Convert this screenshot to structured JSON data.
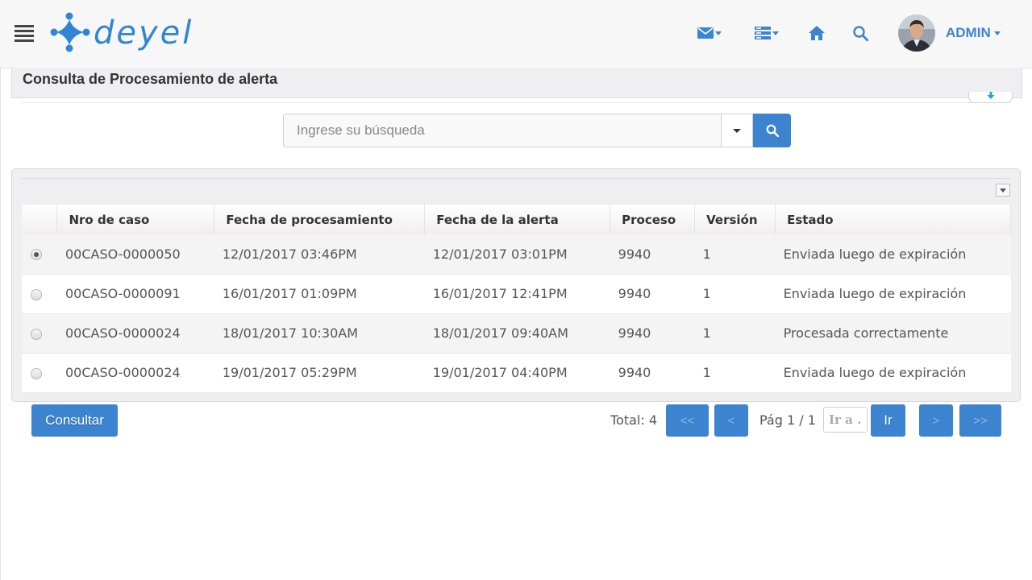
{
  "header": {
    "menu_icon": "hamburger-icon",
    "brand": "deyel",
    "icons": [
      "mail-icon",
      "list-icon",
      "home-icon",
      "search-icon"
    ],
    "user": {
      "name": "ADMIN"
    },
    "accent_color": "#3c84cf"
  },
  "page": {
    "title": "Consulta de Procesamiento de alerta"
  },
  "search": {
    "placeholder": "Ingrese su búsqueda",
    "value": ""
  },
  "table": {
    "columns": [
      "Nro de caso",
      "Fecha de procesamiento",
      "Fecha de la alerta",
      "Proceso",
      "Versión",
      "Estado"
    ],
    "rows": [
      {
        "selected": true,
        "cells": [
          "00CASO-0000050",
          "12/01/2017 03:46PM",
          "12/01/2017 03:01PM",
          "9940",
          "1",
          "Enviada luego de expiración"
        ]
      },
      {
        "selected": false,
        "cells": [
          "00CASO-0000091",
          "16/01/2017 01:09PM",
          "16/01/2017 12:41PM",
          "9940",
          "1",
          "Enviada luego de expiración"
        ]
      },
      {
        "selected": false,
        "cells": [
          "00CASO-0000024",
          "18/01/2017 10:30AM",
          "18/01/2017 09:40AM",
          "9940",
          "1",
          "Procesada correctamente"
        ]
      },
      {
        "selected": false,
        "cells": [
          "00CASO-0000024",
          "19/01/2017 05:29PM",
          "19/01/2017 04:40PM",
          "9940",
          "1",
          "Enviada luego de expiración"
        ]
      }
    ]
  },
  "footer": {
    "consultar_label": "Consultar",
    "total": "Total: 4",
    "first": "<<",
    "prev": "<",
    "page": "Pág 1 / 1",
    "goto_placeholder": "Ir a ..",
    "go": "Ir",
    "next": ">",
    "last": ">>"
  }
}
